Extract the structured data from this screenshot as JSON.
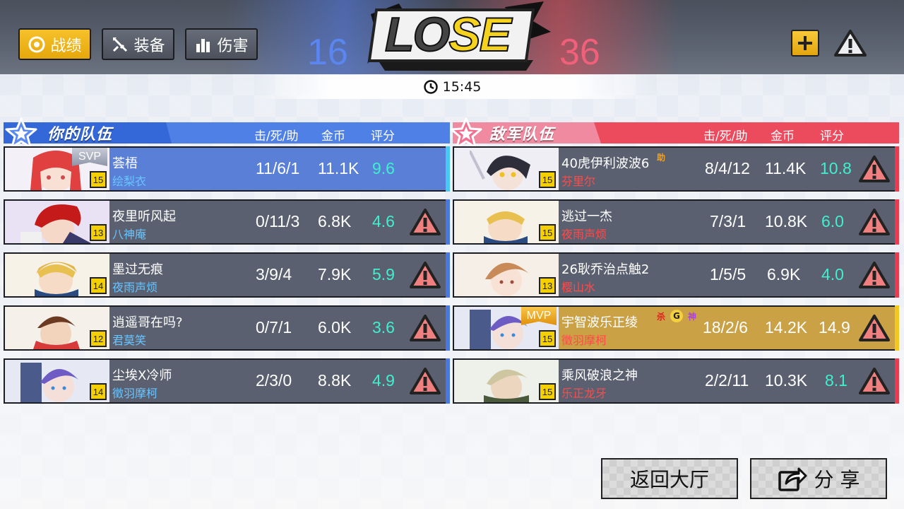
{
  "header": {
    "tabs": [
      {
        "label": "战绩",
        "active": true
      },
      {
        "label": "装备",
        "active": false
      },
      {
        "label": "伤害",
        "active": false
      }
    ],
    "result": "LOSE",
    "score_left": "16",
    "score_right": "36",
    "match_time": "15:45"
  },
  "my_team": {
    "title": "你的队伍",
    "columns": [
      "击/死/助",
      "金币",
      "评分"
    ],
    "players": [
      {
        "name": "荟梧",
        "hero": "绘梨衣",
        "level": "15",
        "kda": "11/6/1",
        "gold": "11.1K",
        "score": "9.6",
        "badge": "SVP"
      },
      {
        "name": "夜里听风起",
        "hero": "八神庵",
        "level": "13",
        "kda": "0/11/3",
        "gold": "6.8K",
        "score": "4.6"
      },
      {
        "name": "墨过无痕",
        "hero": "夜雨声烦",
        "level": "14",
        "kda": "3/9/4",
        "gold": "7.9K",
        "score": "5.9"
      },
      {
        "name": "逍遥哥在吗?",
        "hero": "君莫笑",
        "level": "12",
        "kda": "0/7/1",
        "gold": "6.0K",
        "score": "3.6"
      },
      {
        "name": "尘埃X冷师",
        "hero": "徵羽摩柯",
        "level": "14",
        "kda": "2/3/0",
        "gold": "8.8K",
        "score": "4.9"
      }
    ]
  },
  "enemy_team": {
    "title": "敌军队伍",
    "columns": [
      "击/死/助",
      "金币",
      "评分"
    ],
    "players": [
      {
        "name": "40虎伊利波波6",
        "hero": "芬里尔",
        "level": "15",
        "kda": "8/4/12",
        "gold": "11.4K",
        "score": "10.8",
        "tags": [
          "助"
        ]
      },
      {
        "name": "逃过一杰",
        "hero": "夜雨声烦",
        "level": "15",
        "kda": "7/3/1",
        "gold": "10.8K",
        "score": "6.0"
      },
      {
        "name": "26耿乔治点触2",
        "hero": "樱山水",
        "level": "13",
        "kda": "1/5/5",
        "gold": "6.9K",
        "score": "4.0"
      },
      {
        "name": "宇智波乐正绫",
        "hero": "徵羽摩柯",
        "level": "15",
        "kda": "18/2/6",
        "gold": "14.2K",
        "score": "14.9",
        "badge": "MVP",
        "tags": [
          "杀",
          "G",
          "神"
        ]
      },
      {
        "name": "乘风破浪之神",
        "hero": "乐正龙牙",
        "level": "15",
        "kda": "2/2/11",
        "gold": "10.3K",
        "score": "8.1"
      }
    ]
  },
  "footer": {
    "back_label": "返回大厅",
    "share_label": "分 享"
  },
  "colors": {
    "my_team": "#4f80e6",
    "enemy_team": "#ec4b5e",
    "score_text": "#3ff0cf",
    "gold_active": "#f2b81d",
    "mvp_row": "#caa145",
    "my_hero_name": "#68c4ff",
    "enemy_hero_name": "#ff4a4a"
  }
}
